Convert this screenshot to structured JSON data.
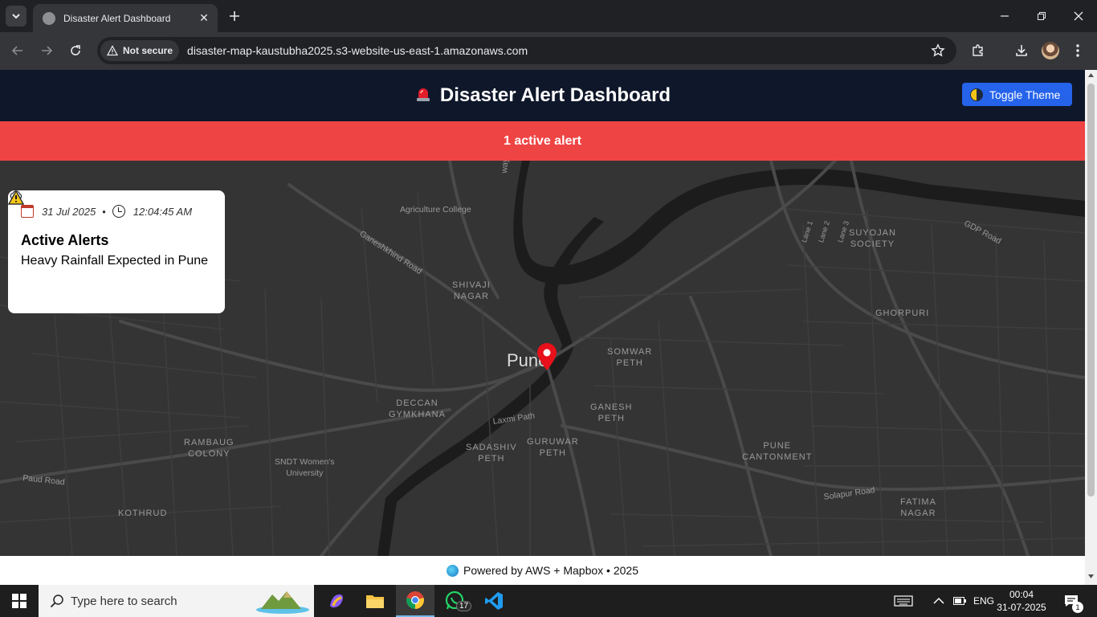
{
  "browser": {
    "tab_title": "Disaster Alert Dashboard",
    "security_label": "Not secure",
    "url": "disaster-map-kaustubha2025.s3-website-us-east-1.amazonaws.com"
  },
  "header": {
    "title": "Disaster Alert Dashboard",
    "toggle_theme_label": "Toggle Theme"
  },
  "alert_banner": {
    "text": "1 active alert"
  },
  "alert_card": {
    "date": "31 Jul 2025",
    "time": "12:04:45 AM",
    "title": "Active Alerts",
    "alert_text": "Heavy Rainfall Expected in Pune"
  },
  "map": {
    "city": "Pune",
    "places": [
      {
        "id": "agriculture-college",
        "label": "Agriculture College"
      },
      {
        "id": "shivaji-nagar",
        "label": "SHIVAJI\nNAGAR"
      },
      {
        "id": "suyojan-society",
        "label": "SUYOJAN\nSOCIETY"
      },
      {
        "id": "ghorpuri",
        "label": "GHORPURI"
      },
      {
        "id": "somwar-peth",
        "label": "SOMWAR\nPETH"
      },
      {
        "id": "deccan-gymkhana",
        "label": "DECCAN\nGYMKHANA"
      },
      {
        "id": "ganesh-peth",
        "label": "GANESH\nPETH"
      },
      {
        "id": "sadashiv-peth",
        "label": "SADASHIV\nPETH"
      },
      {
        "id": "guruwar-peth",
        "label": "GURUWAR\nPETH"
      },
      {
        "id": "rambaug-colony",
        "label": "RAMBAUG\nCOLONY"
      },
      {
        "id": "sndt-university",
        "label": "SNDT Women's\nUniversity"
      },
      {
        "id": "pune-cantonment",
        "label": "PUNE\nCANTONMENT"
      },
      {
        "id": "fatima-nagar",
        "label": "FATIMA\nNAGAR"
      },
      {
        "id": "kothrud",
        "label": "KOTHRUD"
      }
    ],
    "roads": [
      {
        "id": "ganeshkhind-road",
        "label": "Ganeshkhind Road"
      },
      {
        "id": "gdp-road",
        "label": "GDP Road"
      },
      {
        "id": "lane-1",
        "label": "Lane 1"
      },
      {
        "id": "lane-2",
        "label": "Lane 2"
      },
      {
        "id": "lane-3",
        "label": "Lane 3"
      },
      {
        "id": "laxmi-path",
        "label": "Laxmi Path"
      },
      {
        "id": "paud-road",
        "label": "Paud Road"
      },
      {
        "id": "solapur-road",
        "label": "Solapur Road"
      },
      {
        "id": "way",
        "label": "way"
      }
    ]
  },
  "footer": {
    "text": "Powered by AWS + Mapbox • 2025"
  },
  "taskbar": {
    "search_placeholder": "Type here to search",
    "whatsapp_badge": "17",
    "language": "ENG",
    "time": "00:04",
    "date": "31-07-2025",
    "notification_count": "1"
  },
  "colors": {
    "header_bg": "#0f172a",
    "alert_red": "#ef4444",
    "button_blue": "#2563eb",
    "map_bg": "#343434",
    "marker_red": "#e8101a"
  }
}
